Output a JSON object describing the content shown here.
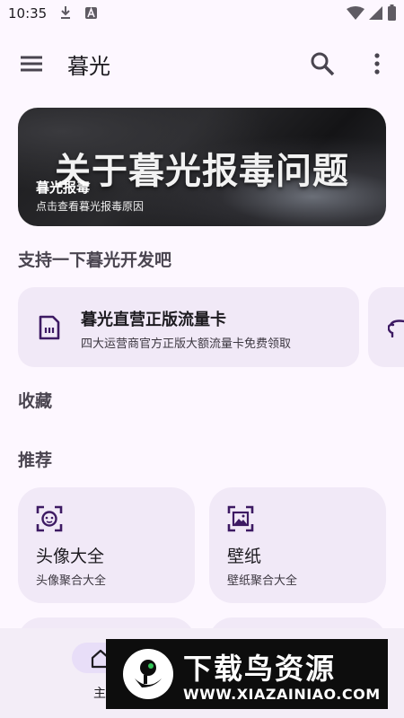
{
  "status_bar": {
    "time": "10:35"
  },
  "app_bar": {
    "title": "暮光",
    "menu_icon": "menu-icon",
    "search_icon": "search-icon",
    "more_icon": "more-vert-icon"
  },
  "banner": {
    "headline": "关于暮光报毒问题",
    "title": "暮光报毒",
    "subtitle": "点击查看暮光报毒原因"
  },
  "support": {
    "section_title": "支持一下暮光开发吧",
    "cards": [
      {
        "icon": "sim-card-icon",
        "title": "暮光直营正版流量卡",
        "desc": "四大运营商官方正版大额流量卡免费领取"
      }
    ]
  },
  "favorites": {
    "section_title": "收藏"
  },
  "recommend": {
    "section_title": "推荐",
    "items": [
      {
        "icon": "face-frame-icon",
        "title": "头像大全",
        "desc": "头像聚合大全"
      },
      {
        "icon": "image-frame-icon",
        "title": "壁纸",
        "desc": "壁纸聚合大全"
      }
    ]
  },
  "bottom_nav": {
    "items": [
      {
        "icon": "home-icon",
        "label": "主"
      }
    ]
  },
  "watermark": {
    "title": "下载鸟资源",
    "url": "WWW.XIAZAINIAO.COM"
  },
  "colors": {
    "background": "#fdf7ff",
    "card": "#f1e9f7",
    "accent": "#4a2b6e"
  }
}
